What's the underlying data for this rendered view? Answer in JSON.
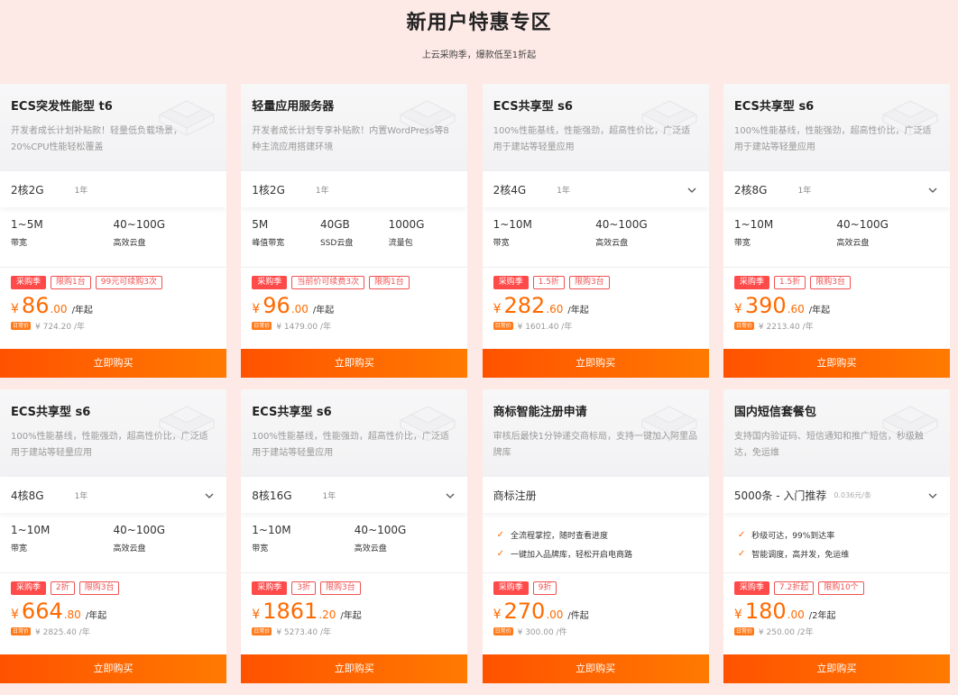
{
  "header": {
    "title": "新用户特惠专区",
    "subtitle": "上云采购季，爆款低至1折起"
  },
  "colors": {
    "accent": "#ff6a00",
    "tag_red": "#f15252",
    "background": "#fde9e5"
  },
  "icons": {
    "chevron": "chevron-down-icon",
    "check": "check-icon",
    "deco": "server-box-icon"
  },
  "cards": [
    {
      "name": "ECS突发性能型 t6",
      "desc": "开发者成长计划补贴款！轻量低负载场景，20%CPU性能轻松覆盖",
      "spec": "2核2G",
      "term": "1年",
      "dropdown": false,
      "features": [
        {
          "value": "1~5M",
          "label": "带宽"
        },
        {
          "value": "40~100G",
          "label": "高效云盘"
        }
      ],
      "tags": [
        "采购季",
        "限购1台",
        "99元可续购3次"
      ],
      "price_int": "86",
      "price_dec": ".00",
      "price_unit": "/年起",
      "orig_badge": "日常价",
      "orig_price": "¥ 724.20 /年",
      "buy": "立即购买"
    },
    {
      "name": "轻量应用服务器",
      "desc": "开发者成长计划专享补贴款！内置WordPress等8种主流应用搭建环境",
      "spec": "1核2G",
      "term": "1年",
      "dropdown": false,
      "features": [
        {
          "value": "5M",
          "label": "峰值带宽"
        },
        {
          "value": "40GB",
          "label": "SSD云盘"
        },
        {
          "value": "1000G",
          "label": "流量包"
        }
      ],
      "tags": [
        "采购季",
        "当前价可续费3次",
        "限购1台"
      ],
      "price_int": "96",
      "price_dec": ".00",
      "price_unit": "/年起",
      "orig_badge": "日常价",
      "orig_price": "¥ 1479.00 /年",
      "buy": "立即购买"
    },
    {
      "name": "ECS共享型 s6",
      "desc": "100%性能基线，性能强劲，超高性价比，广泛适用于建站等轻量应用",
      "spec": "2核4G",
      "term": "1年",
      "dropdown": true,
      "features": [
        {
          "value": "1~10M",
          "label": "带宽"
        },
        {
          "value": "40~100G",
          "label": "高效云盘"
        }
      ],
      "tags": [
        "采购季",
        "1.5折",
        "限购3台"
      ],
      "price_int": "282",
      "price_dec": ".60",
      "price_unit": "/年起",
      "orig_badge": "日常价",
      "orig_price": "¥ 1601.40 /年",
      "buy": "立即购买"
    },
    {
      "name": "ECS共享型 s6",
      "desc": "100%性能基线，性能强劲，超高性价比，广泛适用于建站等轻量应用",
      "spec": "2核8G",
      "term": "1年",
      "dropdown": true,
      "features": [
        {
          "value": "1~10M",
          "label": "带宽"
        },
        {
          "value": "40~100G",
          "label": "高效云盘"
        }
      ],
      "tags": [
        "采购季",
        "1.5折",
        "限购3台"
      ],
      "price_int": "390",
      "price_dec": ".60",
      "price_unit": "/年起",
      "orig_badge": "日常价",
      "orig_price": "¥ 2213.40 /年",
      "buy": "立即购买"
    },
    {
      "name": "ECS共享型 s6",
      "desc": "100%性能基线，性能强劲，超高性价比，广泛适用于建站等轻量应用",
      "spec": "4核8G",
      "term": "1年",
      "dropdown": true,
      "features": [
        {
          "value": "1~10M",
          "label": "带宽"
        },
        {
          "value": "40~100G",
          "label": "高效云盘"
        }
      ],
      "tags": [
        "采购季",
        "2折",
        "限购3台"
      ],
      "price_int": "664",
      "price_dec": ".80",
      "price_unit": "/年起",
      "orig_badge": "日常价",
      "orig_price": "¥ 2825.40 /年",
      "buy": "立即购买"
    },
    {
      "name": "ECS共享型 s6",
      "desc": "100%性能基线，性能强劲，超高性价比，广泛适用于建站等轻量应用",
      "spec": "8核16G",
      "term": "1年",
      "dropdown": true,
      "features": [
        {
          "value": "1~10M",
          "label": "带宽"
        },
        {
          "value": "40~100G",
          "label": "高效云盘"
        }
      ],
      "tags": [
        "采购季",
        "3折",
        "限购3台"
      ],
      "price_int": "1861",
      "price_dec": ".20",
      "price_unit": "/年起",
      "orig_badge": "日常价",
      "orig_price": "¥ 5273.40 /年",
      "buy": "立即购买"
    },
    {
      "name": "商标智能注册申请",
      "desc": "审核后最快1分钟递交商标局，支持一键加入阿里品牌库",
      "spec": "商标注册",
      "term": "",
      "dropdown": false,
      "checks": [
        "全流程掌控，随时查看进度",
        "一键加入品牌库，轻松开启电商路"
      ],
      "tags": [
        "采购季",
        "9折"
      ],
      "price_int": "270",
      "price_dec": ".00",
      "price_unit": "/件起",
      "orig_badge": "日常价",
      "orig_price": "¥ 300.00 /件",
      "buy": "立即购买"
    },
    {
      "name": "国内短信套餐包",
      "desc": "支持国内验证码、短信通知和推广短信，秒级触达，免运维",
      "spec": "5000条 - 入门推荐",
      "term": "0.036元/条",
      "dropdown": true,
      "checks": [
        "秒级可达，99%到达率",
        "智能调度，高并发，免运维"
      ],
      "tags": [
        "采购季",
        "7.2折起",
        "限购10个"
      ],
      "price_int": "180",
      "price_dec": ".00",
      "price_unit": "/2年起",
      "orig_badge": "日常价",
      "orig_price": "¥ 250.00 /2年",
      "buy": "立即购买"
    }
  ]
}
